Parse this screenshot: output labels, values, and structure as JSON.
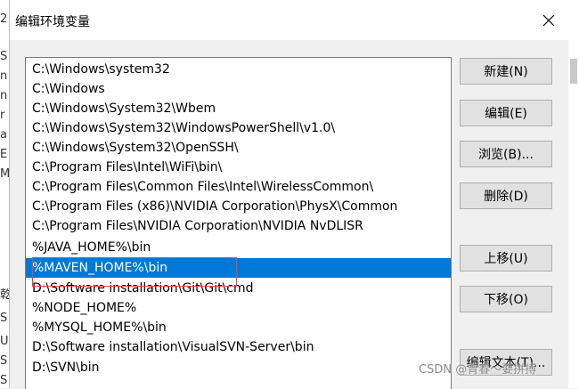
{
  "dialog": {
    "title": "编辑环境变量",
    "close_label": "✕"
  },
  "background_fragments": [
    "2",
    "S",
    "n",
    "n",
    "r",
    "a",
    "E",
    "M",
    "乾",
    "S",
    "U",
    "S",
    "S",
    "S"
  ],
  "paths": [
    "C:\\Windows\\system32",
    "C:\\Windows",
    "C:\\Windows\\System32\\Wbem",
    "C:\\Windows\\System32\\WindowsPowerShell\\v1.0\\",
    "C:\\Windows\\System32\\OpenSSH\\",
    "C:\\Program Files\\Intel\\WiFi\\bin\\",
    "C:\\Program Files\\Common Files\\Intel\\WirelessCommon\\",
    "C:\\Program Files (x86)\\NVIDIA Corporation\\PhysX\\Common",
    "C:\\Program Files\\NVIDIA Corporation\\NVIDIA NvDLISR",
    "%JAVA_HOME%\\bin",
    "%MAVEN_HOME%\\bin",
    "D:\\Software installation\\Git\\Git\\cmd",
    "%NODE_HOME%",
    "%MYSQL_HOME%\\bin",
    "D:\\Software installation\\VisualSVN-Server\\bin",
    "D:\\SVN\\bin"
  ],
  "selected_index": 10,
  "buttons": {
    "new": "新建(N)",
    "edit": "编辑(E)",
    "browse": "浏览(B)...",
    "delete": "删除(D)",
    "move_up": "上移(U)",
    "move_down": "下移(O)",
    "edit_text": "编辑文本(T)..."
  },
  "watermark": "CSDN @青春～要拼搏",
  "colors": {
    "selection": "#0078d7",
    "annotation_box": "#e0474c"
  }
}
